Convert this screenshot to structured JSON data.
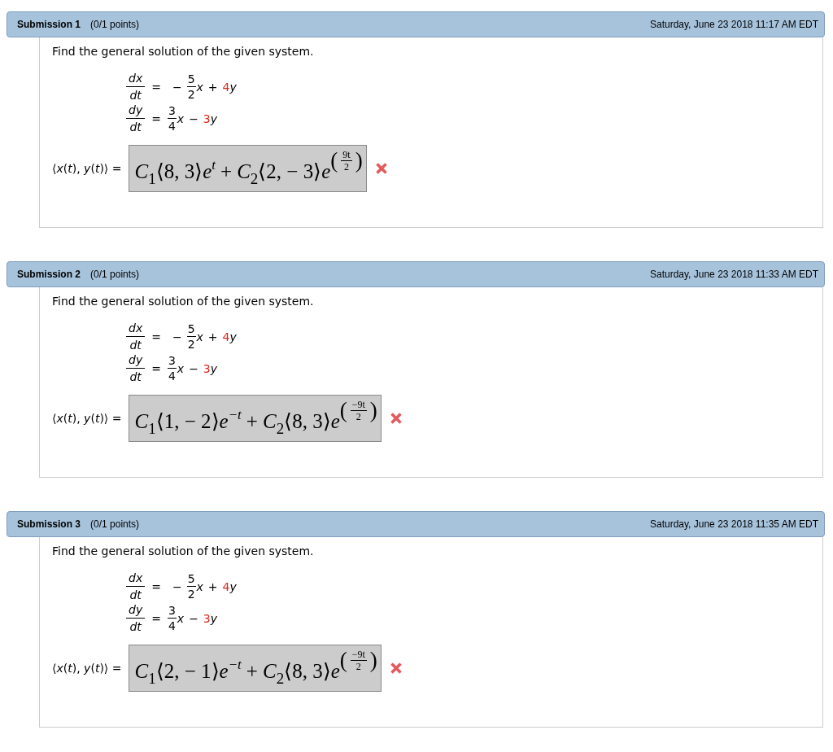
{
  "submissions": [
    {
      "title": "Submission 1",
      "points": "(0/1 points)",
      "timestamp": "Saturday, June 23 2018 11:17 AM EDT",
      "question": "Find the general solution of the given system.",
      "equations": [
        {
          "numerator": "dx",
          "denominator": "dt",
          "relation": "=",
          "rhs": [
            {
              "kind": "operator",
              "text": "−"
            },
            {
              "kind": "fraction",
              "numerator": "5",
              "denominator": "2"
            },
            {
              "kind": "variable",
              "text": "x"
            },
            {
              "kind": "operator",
              "text": "+"
            },
            {
              "kind": "coefficient",
              "text": "4",
              "color": "#d9261c"
            },
            {
              "kind": "variable",
              "text": "y"
            }
          ]
        },
        {
          "numerator": "dy",
          "denominator": "dt",
          "relation": "=",
          "rhs": [
            {
              "kind": "fraction",
              "numerator": "3",
              "denominator": "4"
            },
            {
              "kind": "variable",
              "text": "x"
            },
            {
              "kind": "operator",
              "text": "−"
            },
            {
              "kind": "coefficient",
              "text": "3",
              "color": "#d9261c"
            },
            {
              "kind": "variable",
              "text": "y"
            }
          ]
        }
      ],
      "answer": {
        "label": "⟨*x*(*t*), *y*(*t*)⟩ =",
        "terms": [
          {
            "coefficient": "C",
            "index": "1",
            "vector": "⟨8, 3⟩",
            "base": "e",
            "exponent": {
              "kind": "text",
              "text": "t"
            }
          },
          {
            "sign": "+",
            "coefficient": "C",
            "index": "2",
            "vector": "⟨2,  − 3⟩",
            "base": "e",
            "exponent": {
              "kind": "fraction",
              "open": "(",
              "numerator": "9t",
              "denominator": "2",
              "close": ")"
            }
          }
        ],
        "correct": false
      }
    },
    {
      "title": "Submission 2",
      "points": "(0/1 points)",
      "timestamp": "Saturday, June 23 2018 11:33 AM EDT",
      "question": "Find the general solution of the given system.",
      "equations": [
        {
          "numerator": "dx",
          "denominator": "dt",
          "relation": "=",
          "rhs": [
            {
              "kind": "operator",
              "text": "−"
            },
            {
              "kind": "fraction",
              "numerator": "5",
              "denominator": "2"
            },
            {
              "kind": "variable",
              "text": "x"
            },
            {
              "kind": "operator",
              "text": "+"
            },
            {
              "kind": "coefficient",
              "text": "4",
              "color": "#d9261c"
            },
            {
              "kind": "variable",
              "text": "y"
            }
          ]
        },
        {
          "numerator": "dy",
          "denominator": "dt",
          "relation": "=",
          "rhs": [
            {
              "kind": "fraction",
              "numerator": "3",
              "denominator": "4"
            },
            {
              "kind": "variable",
              "text": "x"
            },
            {
              "kind": "operator",
              "text": "−"
            },
            {
              "kind": "coefficient",
              "text": "3",
              "color": "#d9261c"
            },
            {
              "kind": "variable",
              "text": "y"
            }
          ]
        }
      ],
      "answer": {
        "label": "⟨*x*(*t*), *y*(*t*)⟩ =",
        "terms": [
          {
            "coefficient": "C",
            "index": "1",
            "vector": "⟨1,  − 2⟩",
            "base": "e",
            "exponent": {
              "kind": "text",
              "text": "−t"
            }
          },
          {
            "sign": "+",
            "coefficient": "C",
            "index": "2",
            "vector": "⟨8, 3⟩",
            "base": "e",
            "exponent": {
              "kind": "fraction",
              "open": "(",
              "numerator": "−9t",
              "denominator": "2",
              "close": ")"
            }
          }
        ],
        "correct": false
      }
    },
    {
      "title": "Submission 3",
      "points": "(0/1 points)",
      "timestamp": "Saturday, June 23 2018 11:35 AM EDT",
      "question": "Find the general solution of the given system.",
      "equations": [
        {
          "numerator": "dx",
          "denominator": "dt",
          "relation": "=",
          "rhs": [
            {
              "kind": "operator",
              "text": "−"
            },
            {
              "kind": "fraction",
              "numerator": "5",
              "denominator": "2"
            },
            {
              "kind": "variable",
              "text": "x"
            },
            {
              "kind": "operator",
              "text": "+"
            },
            {
              "kind": "coefficient",
              "text": "4",
              "color": "#d9261c"
            },
            {
              "kind": "variable",
              "text": "y"
            }
          ]
        },
        {
          "numerator": "dy",
          "denominator": "dt",
          "relation": "=",
          "rhs": [
            {
              "kind": "fraction",
              "numerator": "3",
              "denominator": "4"
            },
            {
              "kind": "variable",
              "text": "x"
            },
            {
              "kind": "operator",
              "text": "−"
            },
            {
              "kind": "coefficient",
              "text": "3",
              "color": "#d9261c"
            },
            {
              "kind": "variable",
              "text": "y"
            }
          ]
        }
      ],
      "answer": {
        "label": "⟨*x*(*t*), *y*(*t*)⟩ =",
        "terms": [
          {
            "coefficient": "C",
            "index": "1",
            "vector": "⟨2,  − 1⟩",
            "base": "e",
            "exponent": {
              "kind": "text",
              "text": "−t"
            }
          },
          {
            "sign": "+",
            "coefficient": "C",
            "index": "2",
            "vector": "⟨8, 3⟩",
            "base": "e",
            "exponent": {
              "kind": "fraction",
              "open": "(",
              "numerator": "−9t",
              "denominator": "2",
              "close": ")"
            }
          }
        ],
        "correct": false
      }
    }
  ]
}
